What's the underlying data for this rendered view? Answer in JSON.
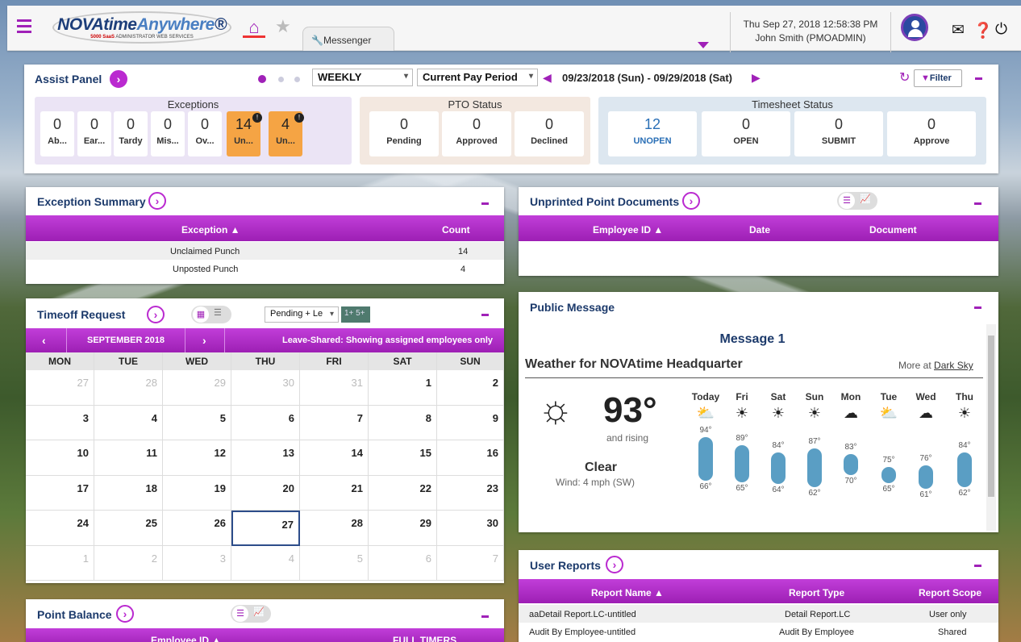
{
  "header": {
    "logo_main": "NOVAtime",
    "logo_accent": "Anywhere",
    "logo_sub_red": "5000 SaaS",
    "logo_sub": "ADMINISTRATOR WEB SERVICES",
    "tab_messenger": "Messenger",
    "datetime": "Thu Sep 27, 2018 12:58:38 PM",
    "user": "John Smith (PMOADMIN)"
  },
  "assist": {
    "title": "Assist Panel",
    "period_type": "WEEKLY",
    "period_sel": "Current Pay Period",
    "date_range": "09/23/2018 (Sun) - 09/29/2018 (Sat)",
    "filter": "Filter",
    "exceptions": {
      "label": "Exceptions",
      "tiles": [
        {
          "n": "0",
          "t": "Ab..."
        },
        {
          "n": "0",
          "t": "Ear..."
        },
        {
          "n": "0",
          "t": "Tardy"
        },
        {
          "n": "0",
          "t": "Mis..."
        },
        {
          "n": "0",
          "t": "Ov..."
        },
        {
          "n": "14",
          "t": "Un..."
        },
        {
          "n": "4",
          "t": "Un..."
        }
      ]
    },
    "pto": {
      "label": "PTO Status",
      "tiles": [
        {
          "n": "0",
          "t": "Pending"
        },
        {
          "n": "0",
          "t": "Approved"
        },
        {
          "n": "0",
          "t": "Declined"
        }
      ]
    },
    "timesheet": {
      "label": "Timesheet Status",
      "tiles": [
        {
          "n": "12",
          "t": "UNOPEN"
        },
        {
          "n": "0",
          "t": "OPEN"
        },
        {
          "n": "0",
          "t": "SUBMIT"
        },
        {
          "n": "0",
          "t": "Approve"
        }
      ]
    }
  },
  "exsum": {
    "title": "Exception Summary",
    "col1": "Exception ▲",
    "col2": "Count",
    "rows": [
      {
        "e": "Unclaimed Punch",
        "c": "14"
      },
      {
        "e": "Unposted Punch",
        "c": "4"
      }
    ]
  },
  "unprinted": {
    "title": "Unprinted Point Documents",
    "col1": "Employee ID ▲",
    "col2": "Date",
    "col3": "Document"
  },
  "timeoff": {
    "title": "Timeoff Request",
    "filter": "Pending + Le",
    "badge": "1+ 5+",
    "month": "SEPTEMBER 2018",
    "note": "Leave-Shared: Showing assigned employees only",
    "dows": [
      "MON",
      "TUE",
      "WED",
      "THU",
      "FRI",
      "SAT",
      "SUN"
    ],
    "weeks": [
      [
        "27",
        "28",
        "29",
        "30",
        "31",
        "1",
        "2"
      ],
      [
        "3",
        "4",
        "5",
        "6",
        "7",
        "8",
        "9"
      ],
      [
        "10",
        "11",
        "12",
        "13",
        "14",
        "15",
        "16"
      ],
      [
        "17",
        "18",
        "19",
        "20",
        "21",
        "22",
        "23"
      ],
      [
        "24",
        "25",
        "26",
        "27",
        "28",
        "29",
        "30"
      ],
      [
        "1",
        "2",
        "3",
        "4",
        "5",
        "6",
        "7"
      ]
    ]
  },
  "pointbal": {
    "title": "Point Balance",
    "col1": "Employee ID ▲",
    "col2": "FULL TIMERS"
  },
  "public": {
    "title": "Public Message",
    "message": "Message 1",
    "weather_title": "Weather for NOVAtime Headquarter",
    "more": "More at",
    "darksky": "Dark Sky",
    "temp": "93°",
    "rising": "and rising",
    "cond": "Clear",
    "wind": "Wind: 4 mph (SW)",
    "days": [
      {
        "d": "Today",
        "hi": "94°",
        "lo": "66°"
      },
      {
        "d": "Fri",
        "hi": "89°",
        "lo": "65°"
      },
      {
        "d": "Sat",
        "hi": "84°",
        "lo": "64°"
      },
      {
        "d": "Sun",
        "hi": "87°",
        "lo": "62°"
      },
      {
        "d": "Mon",
        "hi": "83°",
        "lo": "70°"
      },
      {
        "d": "Tue",
        "hi": "75°",
        "lo": "65°"
      },
      {
        "d": "Wed",
        "hi": "76°",
        "lo": "61°"
      },
      {
        "d": "Thu",
        "hi": "84°",
        "lo": "62°"
      }
    ]
  },
  "reports": {
    "title": "User Reports",
    "col1": "Report Name ▲",
    "col2": "Report Type",
    "col3": "Report Scope",
    "rows": [
      {
        "n": "aaDetail Report.LC-untitled",
        "t": "Detail Report.LC",
        "s": "User only"
      },
      {
        "n": "Audit By Employee-untitled",
        "t": "Audit By Employee",
        "s": "Shared"
      }
    ]
  },
  "colors": {
    "accent": "#a021b8",
    "navy": "#1c3a6b",
    "orange": "#f5a444"
  }
}
